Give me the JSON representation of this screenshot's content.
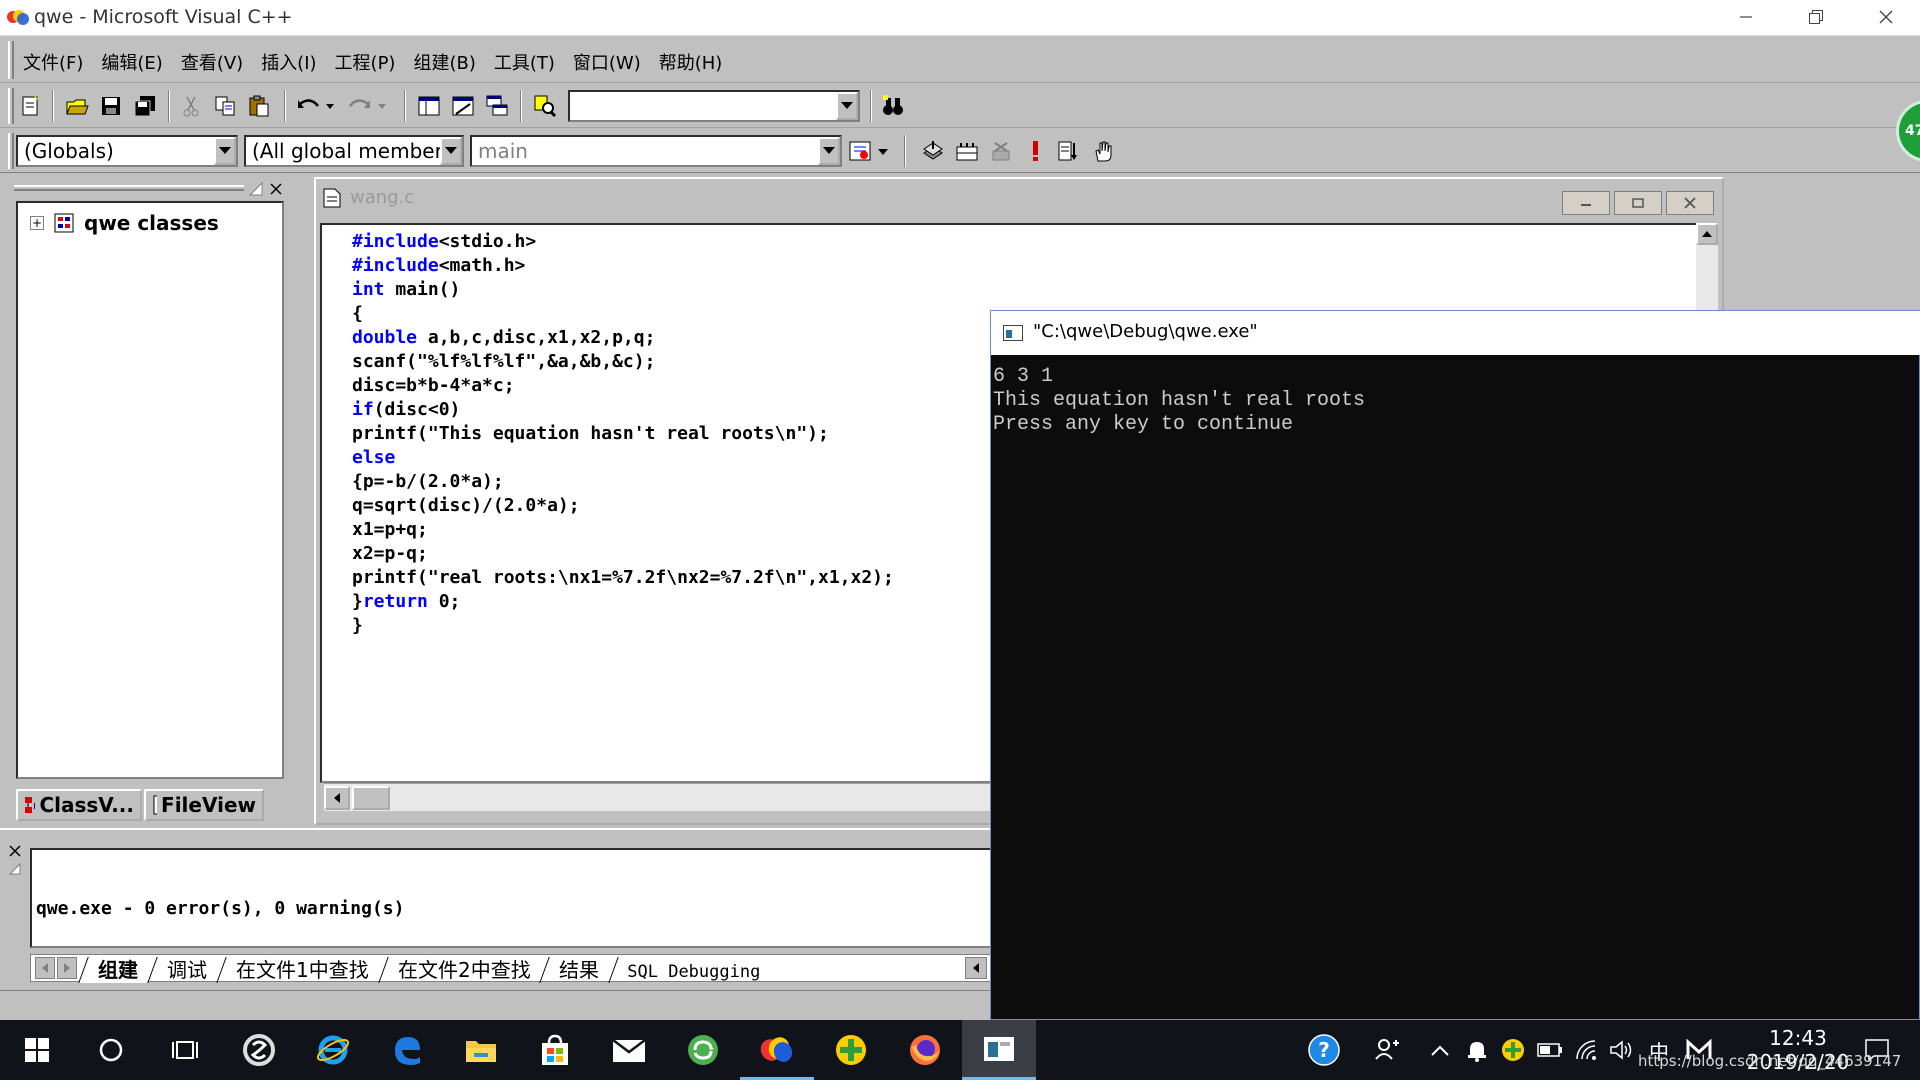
{
  "window": {
    "title": "qwe - Microsoft Visual C++",
    "controls": {
      "minimize": "minimize",
      "maximize": "restore",
      "close": "close"
    }
  },
  "menu": {
    "items": [
      "文件(F)",
      "编辑(E)",
      "查看(V)",
      "插入(I)",
      "工程(P)",
      "组建(B)",
      "工具(T)",
      "窗口(W)",
      "帮助(H)"
    ]
  },
  "toolbar": {
    "find_combo_value": "",
    "globals_combo": "(Globals)",
    "members_combo": "(All global members",
    "function_combo": "main"
  },
  "workspace": {
    "tree_root": "qwe classes",
    "tabs": [
      "ClassV...",
      "FileView"
    ]
  },
  "editor": {
    "filename": "wang.c",
    "lines": [
      [
        {
          "t": "#include",
          "k": true
        },
        {
          "t": "<stdio.h>"
        }
      ],
      [
        {
          "t": "#include",
          "k": true
        },
        {
          "t": "<math.h>"
        }
      ],
      [
        {
          "t": "int",
          "k": true
        },
        {
          "t": " main()"
        }
      ],
      [
        {
          "t": "{"
        }
      ],
      [
        {
          "t": "double",
          "k": true
        },
        {
          "t": " a,b,c,disc,x1,x2,p,q;"
        }
      ],
      [
        {
          "t": "scanf(\"%lf%lf%lf\",&a,&b,&c);"
        }
      ],
      [
        {
          "t": "disc=b*b-4*a*c;"
        }
      ],
      [
        {
          "t": "if",
          "k": true
        },
        {
          "t": "(disc<0)"
        }
      ],
      [
        {
          "t": "printf(\"This equation hasn't real roots\\n\");"
        }
      ],
      [
        {
          "t": "else",
          "k": true
        }
      ],
      [
        {
          "t": "{p=-b/(2.0*a);"
        }
      ],
      [
        {
          "t": "q=sqrt(disc)/(2.0*a);"
        }
      ],
      [
        {
          "t": "x1=p+q;"
        }
      ],
      [
        {
          "t": "x2=p-q;"
        }
      ],
      [
        {
          "t": "printf(\"real roots:\\nx1=%7.2f\\nx2=%7.2f\\n\",x1,x2);"
        }
      ],
      [
        {
          "t": "}"
        },
        {
          "t": "return",
          "k": true
        },
        {
          "t": " 0;"
        }
      ],
      [
        {
          "t": "}"
        }
      ]
    ]
  },
  "output": {
    "message": "qwe.exe - 0 error(s), 0 warning(s)",
    "tabs": [
      "组建",
      "调试",
      "在文件1中查找",
      "在文件2中查找",
      "结果",
      "SQL Debugging"
    ],
    "active_tab": 0
  },
  "console": {
    "title": "\"C:\\qwe\\Debug\\qwe.exe\"",
    "lines": [
      "6 3 1",
      "This equation hasn't real roots",
      "Press any key to continue"
    ]
  },
  "float_widget": {
    "label": "47"
  },
  "taskbar": {
    "clock_time": "12:43",
    "clock_date": "2019/2/20",
    "ime_label": "中",
    "watermark": "https://blog.csdn.net/qq_44639147"
  },
  "colors": {
    "keyword": "#0000ff",
    "chrome": "#c0c0c0",
    "console_bg": "#0c0c0c",
    "taskbar_bg": "#101319"
  }
}
